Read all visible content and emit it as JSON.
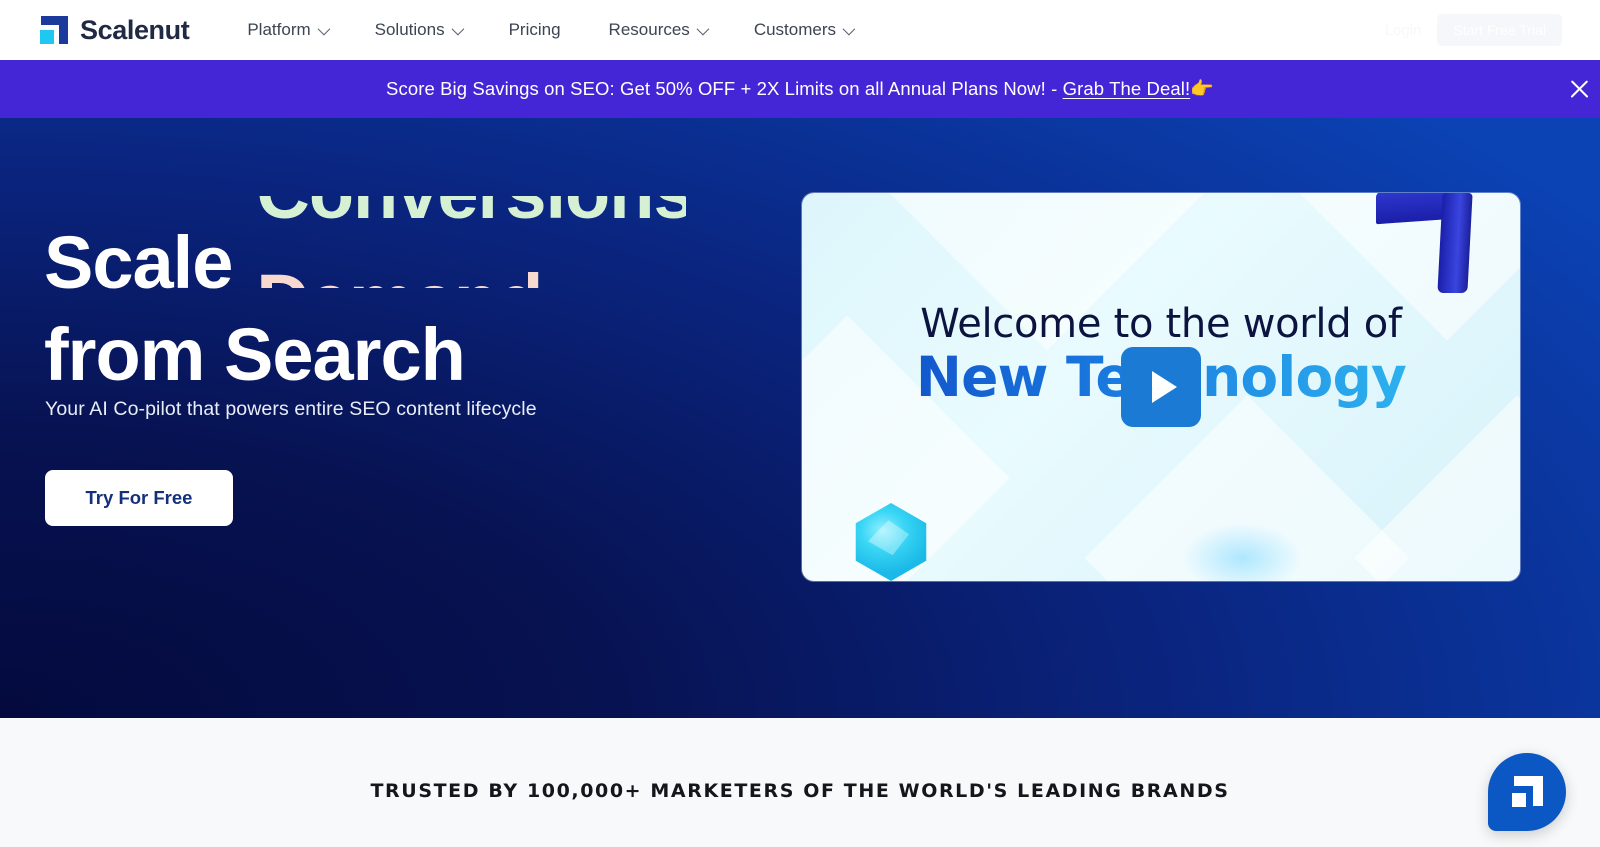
{
  "brand": {
    "name": "Scalenut",
    "logo_icon": "scalenut-logo-icon",
    "accent_dark": "#1b3a9c",
    "accent_cyan": "#1ec8f0"
  },
  "header": {
    "nav": [
      {
        "label": "Platform",
        "has_dropdown": true
      },
      {
        "label": "Solutions",
        "has_dropdown": true
      },
      {
        "label": "Pricing",
        "has_dropdown": false
      },
      {
        "label": "Resources",
        "has_dropdown": true
      },
      {
        "label": "Customers",
        "has_dropdown": true
      }
    ],
    "right": {
      "login_label": "Login",
      "signup_label": "Start Free Trial"
    }
  },
  "promo_banner": {
    "text_before": "Score Big Savings on SEO: Get 50% OFF + 2X Limits on all Annual Plans Now! - ",
    "link_label": "Grab The Deal!",
    "emoji": "👉",
    "background": "#4526d6",
    "close_icon": "close-icon"
  },
  "hero": {
    "headline_static_1": "Scale",
    "headline_static_2": "from Search",
    "rotating_words": [
      {
        "label": "Conversions",
        "color": "#d6f0d3",
        "state": "exiting"
      },
      {
        "label": "Demand",
        "color": "#f7d9d0",
        "state": "entering"
      }
    ],
    "subheading": "Your AI Co-pilot that powers entire SEO content lifecycle",
    "cta_label": "Try For Free",
    "background_gradient": "#040a3d → #0b42b4"
  },
  "video_card": {
    "overlay_line_1": "Welcome to the world of",
    "overlay_line_2": "New Technology",
    "play_icon": "play-icon",
    "play_button_color": "#1a7ad4",
    "decorations": [
      "cyan-gem-icon",
      "scalenut-3d-logo-icon"
    ]
  },
  "trusted_section": {
    "title": "TRUSTED BY 100,000+ MARKETERS OF THE WORLD'S LEADING BRANDS",
    "background": "#f8f9fa"
  },
  "chat_widget": {
    "icon": "scalenut-chat-logo-icon",
    "color": "#0b57c4"
  }
}
